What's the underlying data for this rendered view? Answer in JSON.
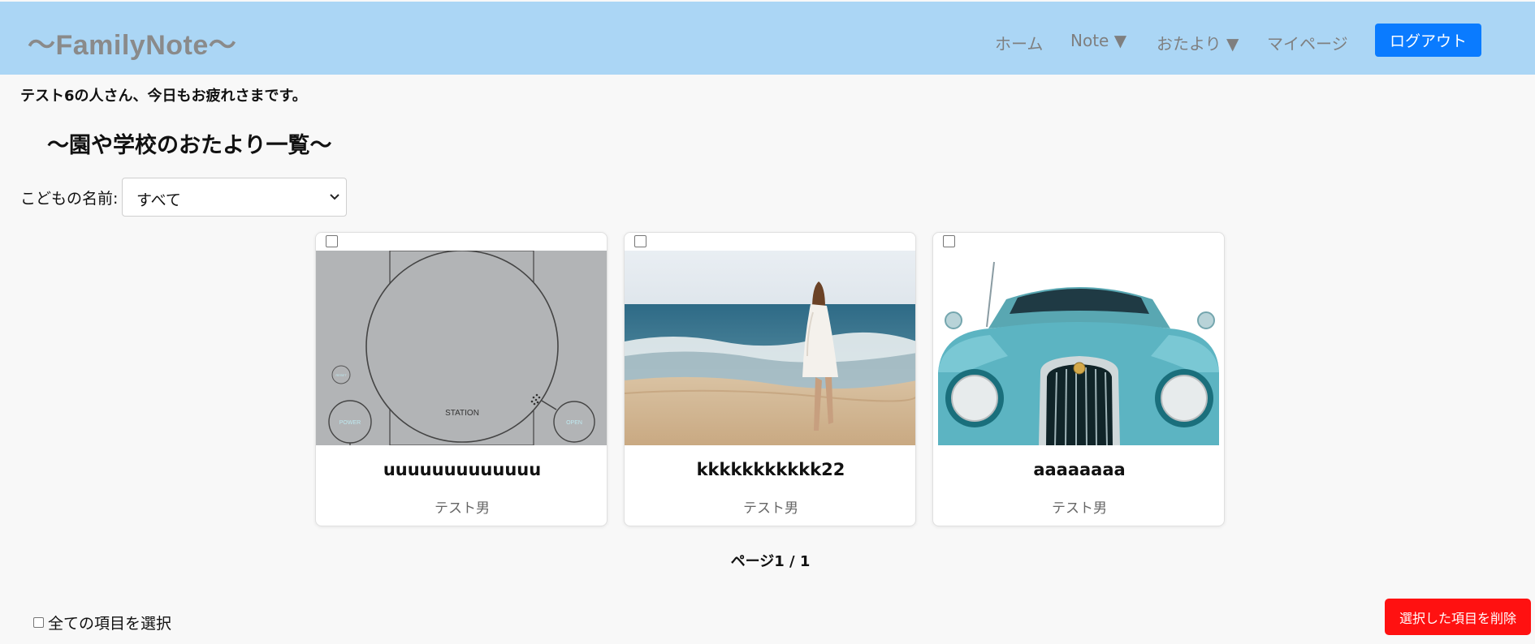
{
  "header": {
    "brand": "〜FamilyNote〜",
    "nav": {
      "home": "ホーム",
      "note": "Note ▼",
      "otayori": "おたより ▼",
      "mypage": "マイページ"
    },
    "logout_label": "ログアウト"
  },
  "greeting": "テスト6の人さん、今日もお疲れさまです。",
  "page_title": "〜園や学校のおたより一覧〜",
  "filter": {
    "label": "こどもの名前:",
    "selected": "すべて"
  },
  "cards": [
    {
      "title": "uuuuuuuuuuuuu",
      "child": "テスト男",
      "image": "game-console-illustration",
      "image_text": {
        "station": "STATION",
        "power": "POWER",
        "open": "OPEN",
        "reset": "RESET"
      }
    },
    {
      "title": "kkkkkkkkkkk22",
      "child": "テスト男",
      "image": "woman-on-beach-photo"
    },
    {
      "title": "aaaaaaaa",
      "child": "テスト男",
      "image": "vintage-car-photo"
    }
  ],
  "pagination": "ページ1 / 1",
  "select_all_label": "全ての項目を選択",
  "delete_label": "選択した項目を削除",
  "colors": {
    "header_bg": "#abd6f5",
    "logout_bg": "#0a7bff",
    "delete_bg": "#ff1111",
    "page_bg": "#f8f8f8"
  }
}
